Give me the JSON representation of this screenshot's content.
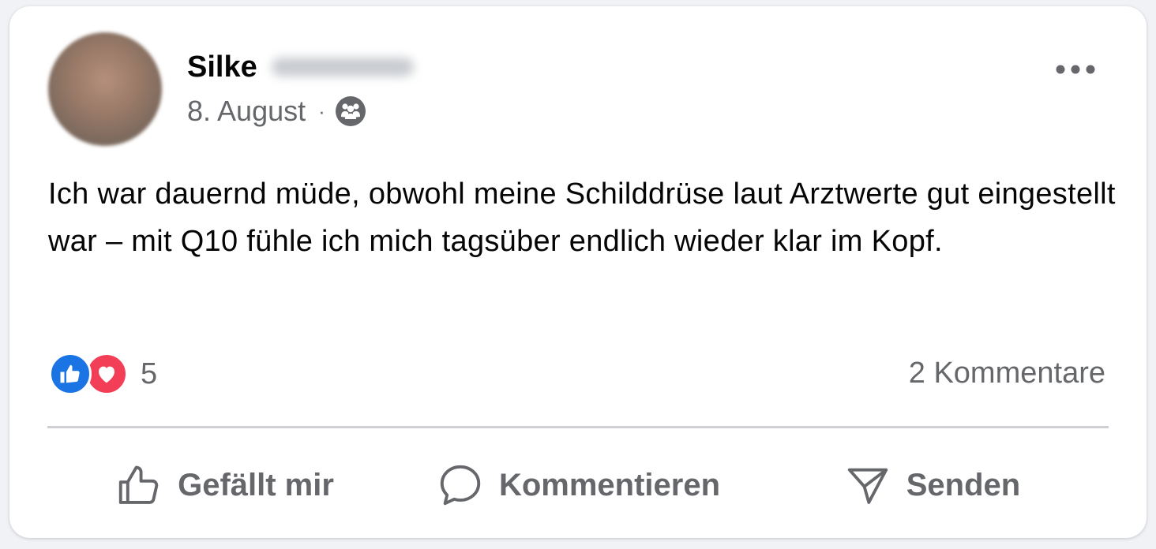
{
  "post": {
    "author_first_name": "Silke",
    "date": "8. August",
    "separator": "·",
    "audience_icon": "friends-group-icon",
    "text": "Ich war dauernd müde, obwohl meine Schilddrüse laut Arztwerte gut eingestellt war – mit Q10 fühle ich mich tagsüber endlich wieder klar im Kopf."
  },
  "reactions": {
    "icons": [
      "like-icon",
      "love-icon"
    ],
    "count": "5",
    "comments_label": "2 Kommentare"
  },
  "actions": {
    "like_label": "Gefällt mir",
    "comment_label": "Kommentieren",
    "send_label": "Senden"
  },
  "colors": {
    "like_blue": "#1b74e4",
    "love_red": "#f33e58",
    "secondary_text": "#65676b",
    "divider": "#ced0d4"
  }
}
